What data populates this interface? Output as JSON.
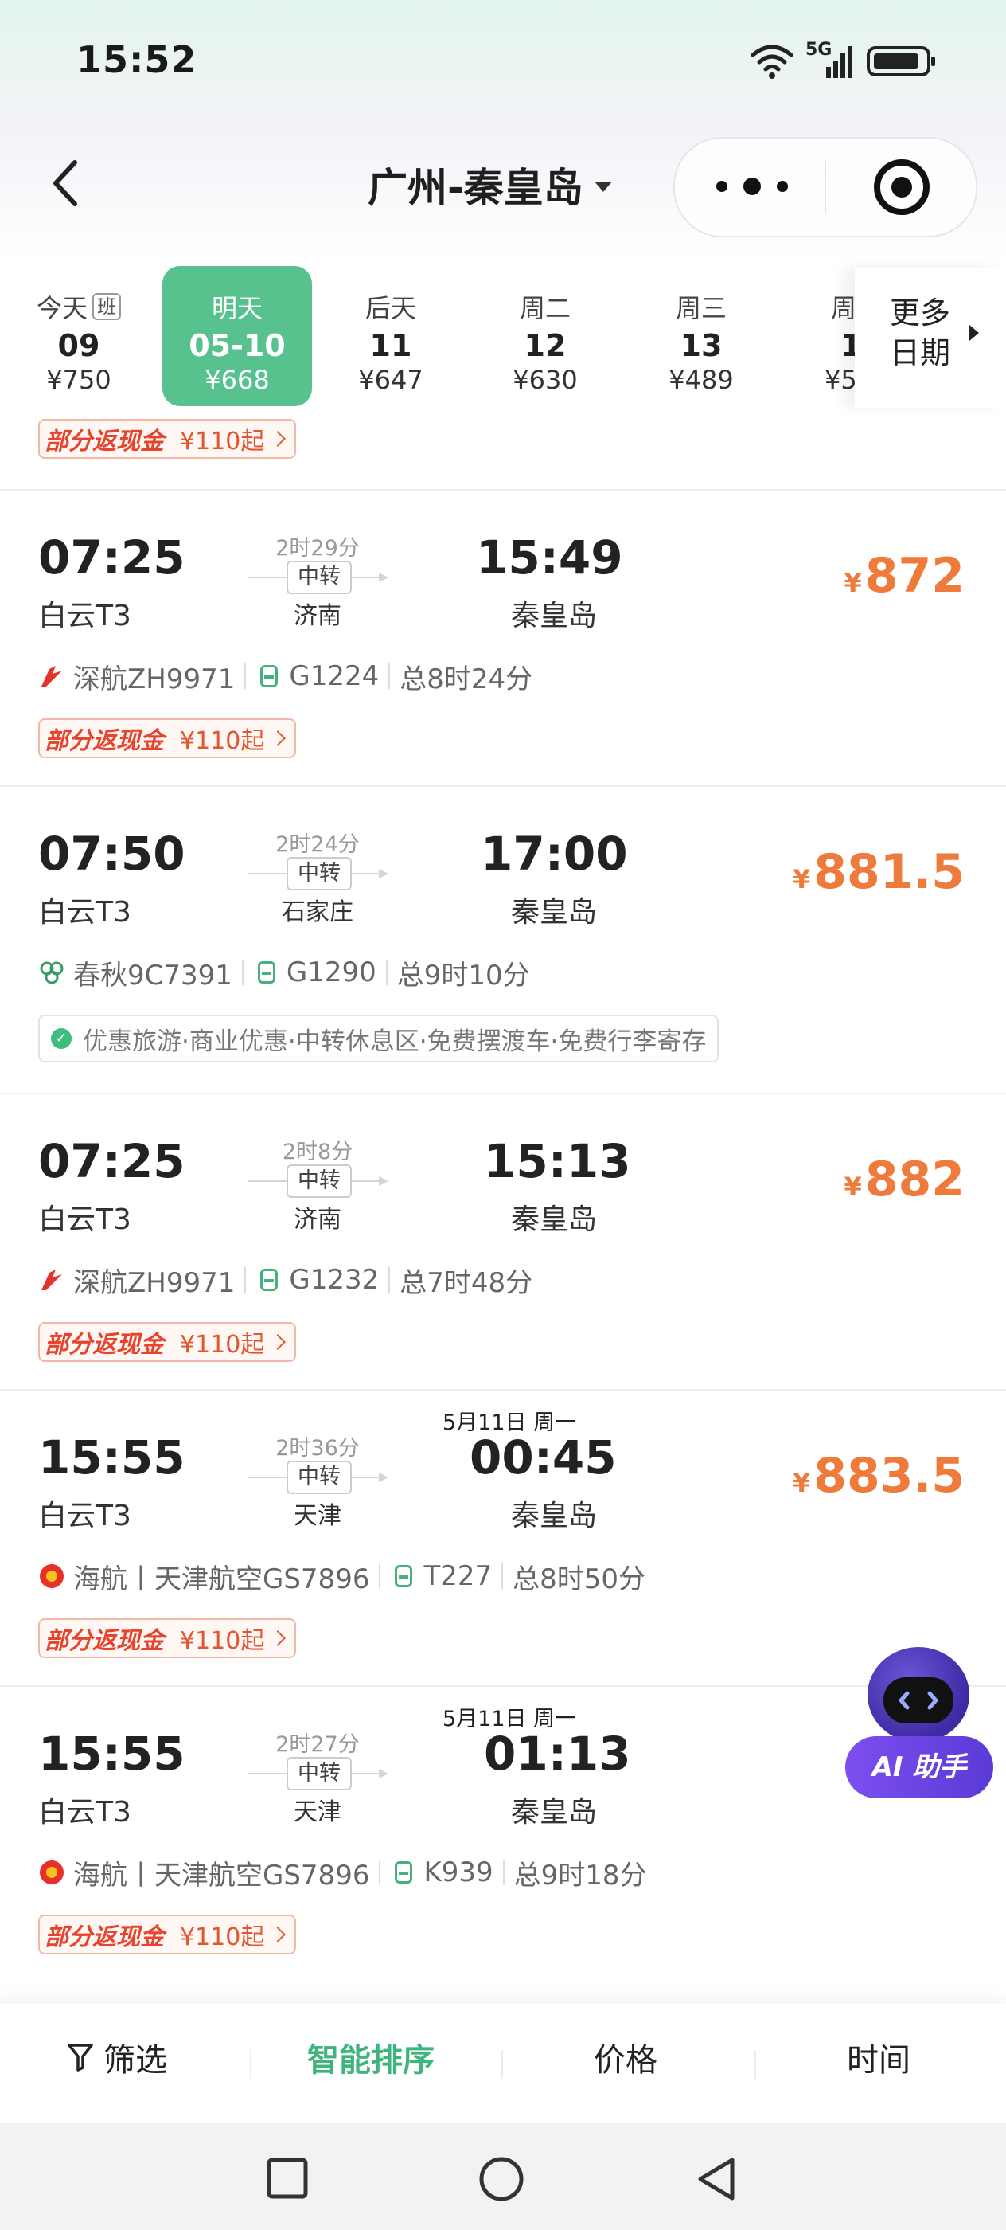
{
  "status_bar": {
    "time": "15:52",
    "network": "5G"
  },
  "nav": {
    "title": "广州-秦皇岛"
  },
  "dates": [
    {
      "day": "今天",
      "badge": "班",
      "date": "09",
      "price": "¥750"
    },
    {
      "day": "明天",
      "date": "05-10",
      "price": "¥668",
      "active": true
    },
    {
      "day": "后天",
      "date": "11",
      "price": "¥647"
    },
    {
      "day": "周二",
      "date": "12",
      "price": "¥630"
    },
    {
      "day": "周三",
      "date": "13",
      "price": "¥489"
    },
    {
      "day": "周",
      "date": "1",
      "price": "¥5"
    }
  ],
  "more_dates": {
    "line1": "更多",
    "line2": "日期"
  },
  "promo": {
    "label": "部分返现金",
    "value": "¥110起"
  },
  "flights": [
    {
      "dep_time": "07:25",
      "dep_airport": "白云T3",
      "duration": "2时29分",
      "transit": "中转",
      "transit_city": "济南",
      "arr_time": "15:49",
      "arr_airport": "秦皇岛",
      "price": "872",
      "airline": "深航ZH9971",
      "train": "G1224",
      "total": "总8时24分",
      "promo": true
    },
    {
      "dep_time": "07:50",
      "dep_airport": "白云T3",
      "duration": "2时24分",
      "transit": "中转",
      "transit_city": "石家庄",
      "arr_time": "17:00",
      "arr_airport": "秦皇岛",
      "price": "881.5",
      "airline": "春秋9C7391",
      "train": "G1290",
      "total": "总9时10分",
      "services": "优惠旅游·商业优惠·中转休息区·免费摆渡车·免费行李寄存"
    },
    {
      "dep_time": "07:25",
      "dep_airport": "白云T3",
      "duration": "2时8分",
      "transit": "中转",
      "transit_city": "济南",
      "arr_time": "15:13",
      "arr_airport": "秦皇岛",
      "price": "882",
      "airline": "深航ZH9971",
      "train": "G1232",
      "total": "总7时48分",
      "promo": true
    },
    {
      "dep_time": "15:55",
      "dep_airport": "白云T3",
      "duration": "2时36分",
      "transit": "中转",
      "transit_city": "天津",
      "next_day": "5月11日 周一",
      "arr_time": "00:45",
      "arr_airport": "秦皇岛",
      "price": "883.5",
      "airline": "海航丨天津航空GS7896",
      "train": "T227",
      "total": "总8时50分",
      "promo": true
    },
    {
      "dep_time": "15:55",
      "dep_airport": "白云T3",
      "duration": "2时27分",
      "transit": "中转",
      "transit_city": "天津",
      "next_day": "5月11日 周一",
      "arr_time": "01:13",
      "arr_airport": "秦皇岛",
      "price": "",
      "airline": "海航丨天津航空GS7896",
      "train": "K939",
      "total": "总9时18分",
      "promo": true
    }
  ],
  "ai_helper": {
    "label": "AI 助手"
  },
  "sort_bar": {
    "filter": "筛选",
    "smart": "智能排序",
    "price": "价格",
    "time": "时间"
  },
  "icons": {
    "back": "chevron-left-icon",
    "more": "more-dots-icon",
    "target": "target-icon",
    "train": "train-icon",
    "filter": "filter-icon"
  },
  "colors": {
    "accent": "#57c28d",
    "price": "#ee7a3c",
    "promo": "#e8432c"
  }
}
